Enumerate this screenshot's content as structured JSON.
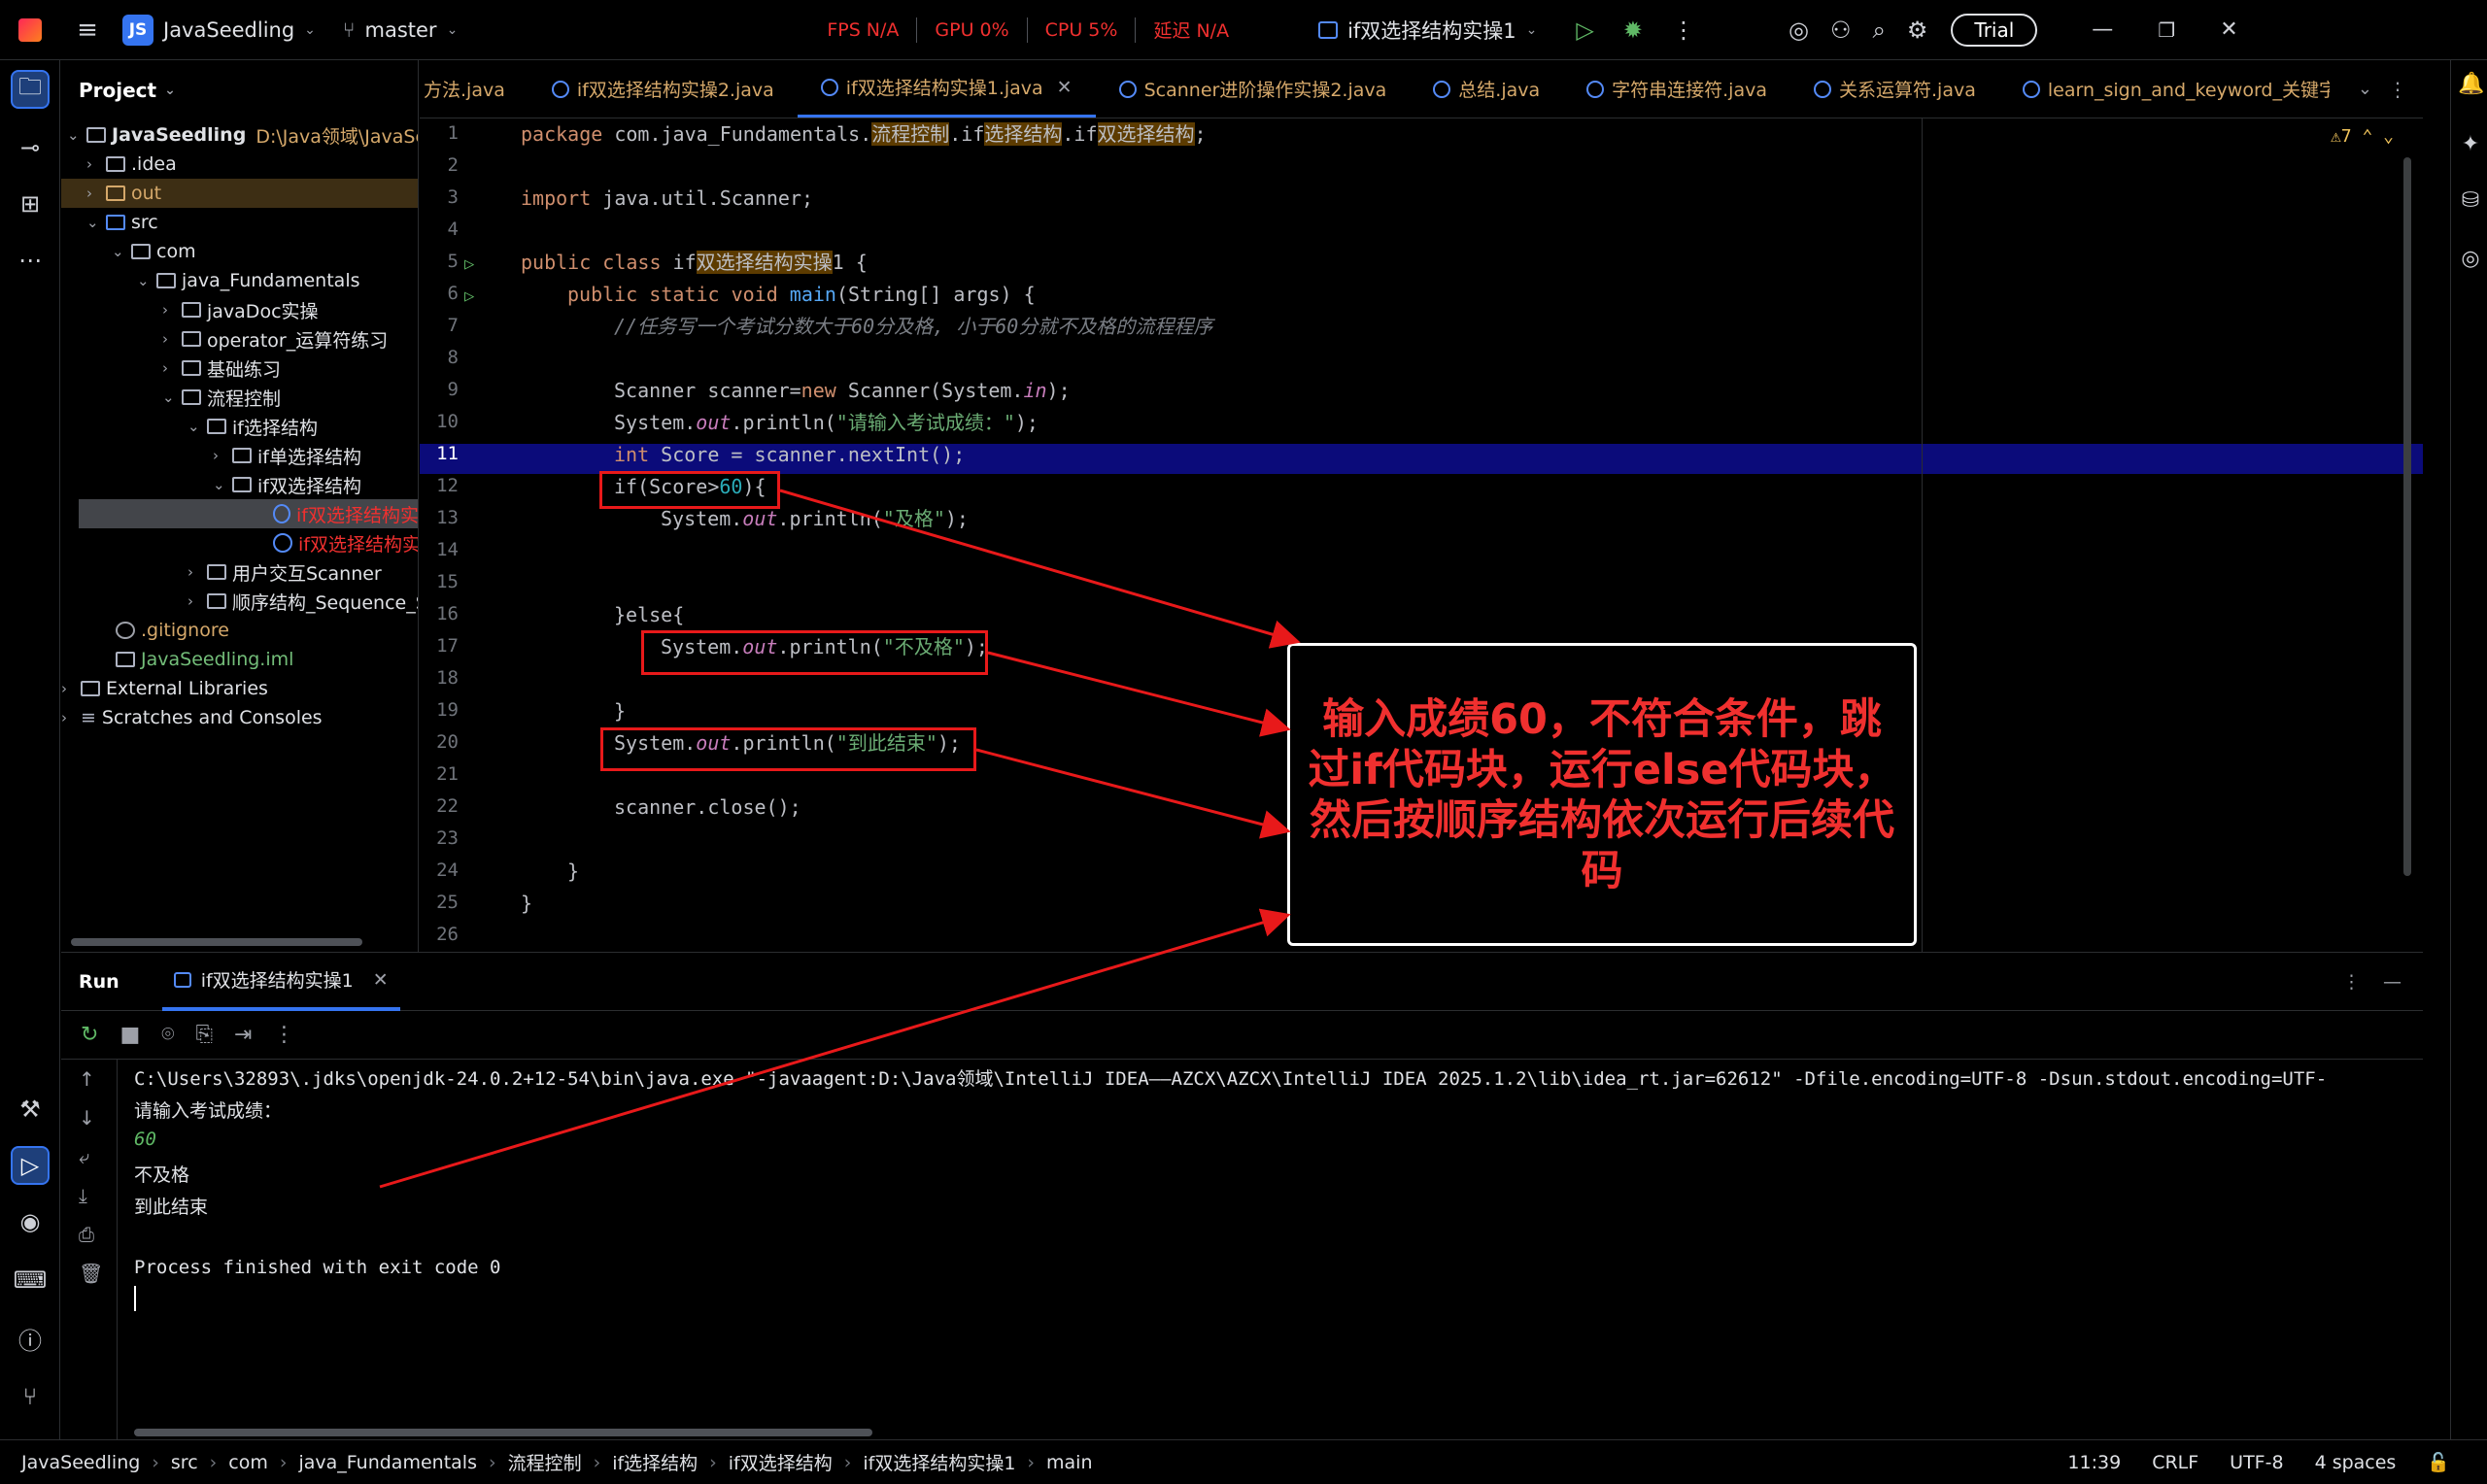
{
  "titlebar": {
    "project_badge": "JS",
    "project_name": "JavaSeedling",
    "branch": "master",
    "metrics": [
      {
        "label": "FPS",
        "value": "N/A"
      },
      {
        "label": "GPU",
        "value": "0%"
      },
      {
        "label": "CPU",
        "value": "5%"
      },
      {
        "label": "延迟",
        "value": "N/A"
      }
    ],
    "run_config": "if双选择结构实操1",
    "trial_label": "Trial"
  },
  "project_panel": {
    "title": "Project",
    "tree": [
      {
        "label": "JavaSeedling",
        "extra": "D:\\Java领域\\JavaSeedl"
      },
      {
        "label": ".idea"
      },
      {
        "label": "out"
      },
      {
        "label": "src"
      },
      {
        "label": "com"
      },
      {
        "label": "java_Fundamentals"
      },
      {
        "label": "javaDoc实操"
      },
      {
        "label": "operator_运算符练习"
      },
      {
        "label": "基础练习"
      },
      {
        "label": "流程控制"
      },
      {
        "label": "if选择结构"
      },
      {
        "label": "if单选择结构"
      },
      {
        "label": "if双选择结构"
      },
      {
        "label": "if双选择结构实"
      },
      {
        "label": "if双选择结构实"
      },
      {
        "label": "用户交互Scanner"
      },
      {
        "label": "顺序结构_Sequence_S"
      },
      {
        "label": ".gitignore"
      },
      {
        "label": "JavaSeedling.iml"
      },
      {
        "label": "External Libraries"
      },
      {
        "label": "Scratches and Consoles"
      }
    ]
  },
  "tabs": [
    {
      "label": "方法.java"
    },
    {
      "label": "if双选择结构实操2.java"
    },
    {
      "label": "if双选择结构实操1.java"
    },
    {
      "label": "Scanner进阶操作实操2.java"
    },
    {
      "label": "总结.java"
    },
    {
      "label": "字符串连接符.java"
    },
    {
      "label": "关系运算符.java"
    },
    {
      "label": "learn_sign_and_keyword_关键字"
    }
  ],
  "editor": {
    "warning_count": "7",
    "line_numbers": [
      "1",
      "2",
      "3",
      "4",
      "5",
      "6",
      "7",
      "8",
      "9",
      "10",
      "11",
      "12",
      "13",
      "14",
      "15",
      "16",
      "17",
      "18",
      "19",
      "20",
      "21",
      "22",
      "23",
      "24",
      "25",
      "26"
    ],
    "code": {
      "l1_kw": "package",
      "l1_a": " com.java_Fundamentals.",
      "l1_h1": "流程控制",
      "l1_b": ".if",
      "l1_h2": "选择结构",
      "l1_c": ".if",
      "l1_h3": "双选择结构",
      "l1_d": ";",
      "l3_kw": "import",
      "l3_a": " java.util.Scanner;",
      "l5_kw": "public class",
      "l5_a": " if",
      "l5_h": "双选择结构实操",
      "l5_b": "1 {",
      "l6_kw": "public static void",
      "l6_fn": " main",
      "l6_a": "(String[] args) {",
      "l7_cmt": "//任务写一个考试分数大于60分及格, 小于60分就不及格的流程程序",
      "l9_a": "Scanner scanner=",
      "l9_kw": "new",
      "l9_b": " Scanner(System.",
      "l9_fld": "in",
      "l9_c": ");",
      "l10_a": "System.",
      "l10_fld": "out",
      "l10_b": ".println(",
      "l10_str": "\"请输入考试成绩：\"",
      "l10_c": ");",
      "l11_kw": "int",
      "l11_a": " Score = scanner.nextInt();",
      "l12_a": "if(Score>",
      "l12_num": "60",
      "l12_b": "){",
      "l13_a": "System.",
      "l13_fld": "out",
      "l13_b": ".println(",
      "l13_str": "\"及格\"",
      "l13_c": ");",
      "l16_a": "}else{",
      "l17_a": "System.",
      "l17_fld": "out",
      "l17_b": ".println(",
      "l17_str": "\"不及格\"",
      "l17_c": ");",
      "l19_a": "}",
      "l20_a": "System.",
      "l20_fld": "out",
      "l20_b": ".println(",
      "l20_str": "\"到此结束\"",
      "l20_c": ");",
      "l22_a": "scanner.close();",
      "l24_a": "}",
      "l25_a": "}"
    }
  },
  "callout": {
    "text": "输入成绩60，不符合条件，跳过if代码块，运行else代码块，然后按顺序结构依次运行后续代码"
  },
  "run_panel": {
    "title": "Run",
    "tab_label": "if双选择结构实操1",
    "console": {
      "command": "C:\\Users\\32893\\.jdks\\openjdk-24.0.2+12-54\\bin\\java.exe \"-javaagent:D:\\Java领域\\IntelliJ IDEA——AZCX\\AZCX\\IntelliJ IDEA 2025.1.2\\lib\\idea_rt.jar=62612\" -Dfile.encoding=UTF-8 -Dsun.stdout.encoding=UTF-",
      "prompt": "请输入考试成绩：",
      "input": "60",
      "out1": "不及格",
      "out2": "到此结束",
      "exit": "Process finished with exit code 0"
    }
  },
  "statusbar": {
    "breadcrumbs": [
      "JavaSeedling",
      "src",
      "com",
      "java_Fundamentals",
      "流程控制",
      "if选择结构",
      "if双选择结构",
      "if双选择结构实操1",
      "main"
    ],
    "position": "11:39",
    "line_sep": "CRLF",
    "encoding": "UTF-8",
    "indent": "4 spaces"
  },
  "colors": {
    "accent": "#3574f0",
    "annotation_red": "#e8191a",
    "line_highlight": "#0b0b7a"
  }
}
